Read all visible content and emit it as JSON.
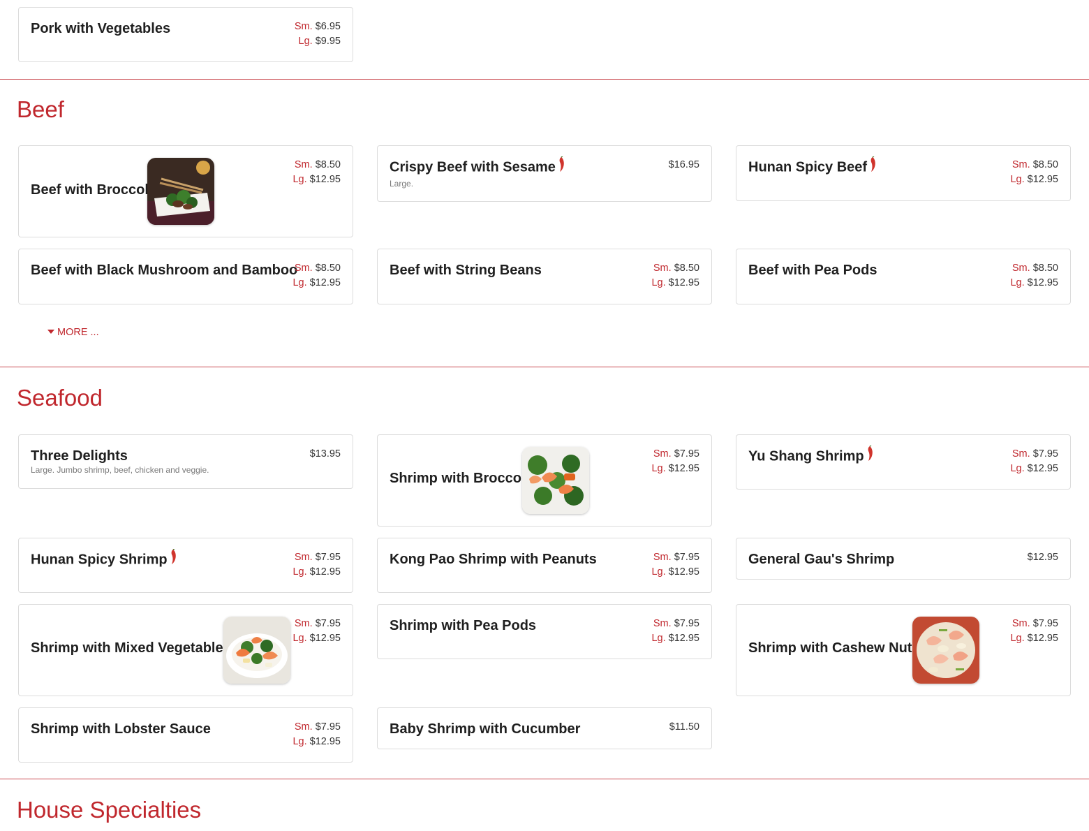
{
  "colors": {
    "accent": "#c0272d",
    "divider": "#c94a50",
    "card_border": "#dcdcdc"
  },
  "pork": {
    "item1": {
      "name": "Pork with Vegetables",
      "sm_label": "Sm.",
      "sm": "$6.95",
      "lg_label": "Lg.",
      "lg": "$9.95"
    }
  },
  "beef": {
    "title": "Beef",
    "more_label": "MORE ...",
    "item1": {
      "name": "Beef with Broccoli",
      "sm_label": "Sm.",
      "sm": "$8.50",
      "lg_label": "Lg.",
      "lg": "$12.95",
      "image": "beef-broccoli-photo"
    },
    "item2": {
      "name": "Crispy Beef with Sesame",
      "price": "$16.95",
      "desc": "Large.",
      "spicy": true
    },
    "item3": {
      "name": "Hunan Spicy Beef",
      "sm_label": "Sm.",
      "sm": "$8.50",
      "lg_label": "Lg.",
      "lg": "$12.95",
      "spicy": true
    },
    "item4": {
      "name": "Beef with Black Mushroom and Bamboo",
      "sm_label": "Sm.",
      "sm": "$8.50",
      "lg_label": "Lg.",
      "lg": "$12.95"
    },
    "item5": {
      "name": "Beef with String Beans",
      "sm_label": "Sm.",
      "sm": "$8.50",
      "lg_label": "Lg.",
      "lg": "$12.95"
    },
    "item6": {
      "name": "Beef with Pea Pods",
      "sm_label": "Sm.",
      "sm": "$8.50",
      "lg_label": "Lg.",
      "lg": "$12.95"
    }
  },
  "seafood": {
    "title": "Seafood",
    "item1": {
      "name": "Three Delights",
      "price": "$13.95",
      "desc": "Large. Jumbo shrimp, beef, chicken and veggie."
    },
    "item2": {
      "name": "Shrimp with Broccoli",
      "sm_label": "Sm.",
      "sm": "$7.95",
      "lg_label": "Lg.",
      "lg": "$12.95",
      "image": "shrimp-broccoli-photo"
    },
    "item3": {
      "name": "Yu Shang Shrimp",
      "sm_label": "Sm.",
      "sm": "$7.95",
      "lg_label": "Lg.",
      "lg": "$12.95",
      "spicy": true
    },
    "item4": {
      "name": "Hunan Spicy Shrimp",
      "sm_label": "Sm.",
      "sm": "$7.95",
      "lg_label": "Lg.",
      "lg": "$12.95",
      "spicy": true
    },
    "item5": {
      "name": "Kong Pao Shrimp with Peanuts",
      "sm_label": "Sm.",
      "sm": "$7.95",
      "lg_label": "Lg.",
      "lg": "$12.95"
    },
    "item6": {
      "name": "General Gau's Shrimp",
      "price": "$12.95"
    },
    "item7": {
      "name": "Shrimp with Mixed Vegetables",
      "sm_label": "Sm.",
      "sm": "$7.95",
      "lg_label": "Lg.",
      "lg": "$12.95",
      "image": "shrimp-mixed-vegetables-photo"
    },
    "item8": {
      "name": "Shrimp with Pea Pods",
      "sm_label": "Sm.",
      "sm": "$7.95",
      "lg_label": "Lg.",
      "lg": "$12.95"
    },
    "item9": {
      "name": "Shrimp with Cashew Nuts",
      "sm_label": "Sm.",
      "sm": "$7.95",
      "lg_label": "Lg.",
      "lg": "$12.95",
      "image": "shrimp-cashew-photo"
    },
    "item10": {
      "name": "Shrimp with Lobster Sauce",
      "sm_label": "Sm.",
      "sm": "$7.95",
      "lg_label": "Lg.",
      "lg": "$12.95"
    },
    "item11": {
      "name": "Baby Shrimp with Cucumber",
      "price": "$11.50"
    }
  },
  "house": {
    "title": "House Specialties"
  }
}
